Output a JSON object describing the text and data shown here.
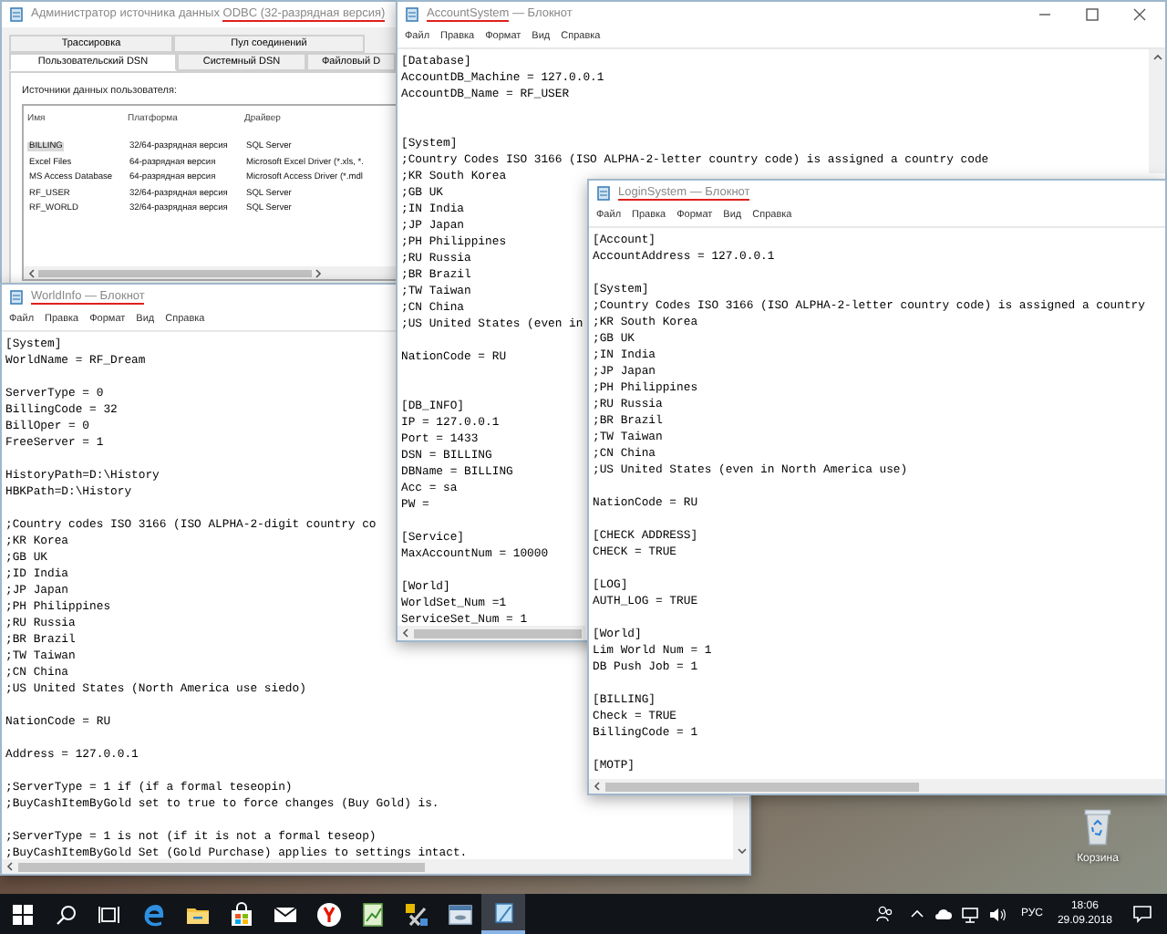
{
  "windows": [
    {
      "kind": "odbc",
      "title": [
        {
          "text": "Администратор источника данных",
          "underlined": false
        },
        {
          "text": "ODBC (32-разрядная версия)",
          "underlined": true
        }
      ],
      "tab_rows": [
        [
          {
            "label": "Трассировка",
            "selected": false
          },
          {
            "label": "Пул соединений",
            "selected": false
          }
        ],
        [
          {
            "label": "Пользовательский DSN",
            "selected": true
          },
          {
            "label": "Системный DSN",
            "selected": false
          },
          {
            "label": "Файловый D",
            "selected": false
          }
        ]
      ],
      "list_label": "Источники данных пользователя:",
      "table": {
        "columns": [
          "Имя",
          "Платформа",
          "Драйвер"
        ],
        "rows": [
          {
            "cells": [
              "BILLING",
              "32/64-разрядная версия",
              "SQL Server"
            ],
            "selected": true
          },
          {
            "cells": [
              "Excel Files",
              "64-разрядная версия",
              "Microsoft Excel Driver (*.xls, *."
            ],
            "selected": false
          },
          {
            "cells": [
              "MS Access Database",
              "64-разрядная версия",
              "Microsoft Access Driver (*.mdl"
            ],
            "selected": false
          },
          {
            "cells": [
              "RF_USER",
              "32/64-разрядная версия",
              "SQL Server"
            ],
            "selected": false
          },
          {
            "cells": [
              "RF_WORLD",
              "32/64-разрядная версия",
              "SQL Server"
            ],
            "selected": false
          }
        ]
      }
    },
    {
      "kind": "notepad",
      "title": [
        {
          "text": "WorldInfo — Блокнот",
          "underlined": true
        }
      ],
      "menu": [
        "Файл",
        "Правка",
        "Формат",
        "Вид",
        "Справка"
      ],
      "text": "[System]\nWorldName = RF_Dream\n\nServerType = 0\nBillingCode = 32\nBillOper = 0\nFreeServer = 1\n\nHistoryPath=D:\\History\nHBKPath=D:\\History\n\n;Country codes ISO 3166 (ISO ALPHA-2-digit country co\n;KR Korea\n;GB UK\n;ID India\n;JP Japan\n;PH Philippines\n;RU Russia\n;BR Brazil\n;TW Taiwan\n;CN China\n;US United States (North America use siedo)\n\nNationCode = RU\n\nAddress = 127.0.0.1\n\n;ServerType = 1 if (if a formal teseopin)\n;BuyCashItemByGold set to true to force changes (Buy Gold) is.\n\n;ServerType = 1 is not (if it is not a formal teseop)\n;BuyCashItemByGold Set (Gold Purchase) applies to settings intact."
    },
    {
      "kind": "notepad",
      "title": [
        {
          "text": "AccountSystem",
          "underlined": true
        },
        {
          "text": "— Блокнот",
          "underlined": false
        }
      ],
      "menu": [
        "Файл",
        "Правка",
        "Формат",
        "Вид",
        "Справка"
      ],
      "text": "[Database]\nAccountDB_Machine = 127.0.0.1\nAccountDB_Name = RF_USER\n\n\n[System]\n;Country Codes ISO 3166 (ISO ALPHA-2-letter country code) is assigned a country code\n;KR South Korea\n;GB UK\n;IN India\n;JP Japan\n;PH Philippines\n;RU Russia\n;BR Brazil\n;TW Taiwan\n;CN China\n;US United States (even in\n\nNationCode = RU\n\n\n[DB_INFO]\nIP = 127.0.0.1\nPort = 1433\nDSN = BILLING\nDBName = BILLING\nAcc = sa\nPW =\n\n[Service]\nMaxAccountNum = 10000\n\n[World]\nWorldSet_Num =1\nServiceSet_Num = 1"
    },
    {
      "kind": "notepad",
      "title": [
        {
          "text": "LoginSystem — Блокнот",
          "underlined": true
        }
      ],
      "menu": [
        "Файл",
        "Правка",
        "Формат",
        "Вид",
        "Справка"
      ],
      "text": "[Account]\nAccountAddress = 127.0.0.1\n\n[System]\n;Country Codes ISO 3166 (ISO ALPHA-2-letter country code) is assigned a country\n;KR South Korea\n;GB UK\n;IN India\n;JP Japan\n;PH Philippines\n;RU Russia\n;BR Brazil\n;TW Taiwan\n;CN China\n;US United States (even in North America use)\n\nNationCode = RU\n\n[CHECK ADDRESS]\nCHECK = TRUE\n\n[LOG]\nAUTH_LOG = TRUE\n\n[World]\nLim World Num = 1\nDB Push Job = 1\n\n[BILLING]\nCheck = TRUE\nBillingCode = 1\n\n[MOTP]"
    }
  ],
  "desktop_icons": [
    {
      "label": "Корзина"
    }
  ],
  "taskbar": {
    "apps": [
      {
        "kind": "start",
        "active": false
      },
      {
        "kind": "search",
        "active": false
      },
      {
        "kind": "taskview",
        "active": false
      },
      {
        "kind": "edge",
        "active": false
      },
      {
        "kind": "explorer",
        "active": false
      },
      {
        "kind": "store",
        "active": false
      },
      {
        "kind": "mail",
        "active": false
      },
      {
        "kind": "yandex",
        "active": false
      },
      {
        "kind": "chart",
        "active": false
      },
      {
        "kind": "tools",
        "active": false
      },
      {
        "kind": "odbc",
        "active": false
      },
      {
        "kind": "notepad",
        "active": true
      }
    ],
    "language": "РУС",
    "time": "18:06",
    "date": "29.09.2018"
  }
}
